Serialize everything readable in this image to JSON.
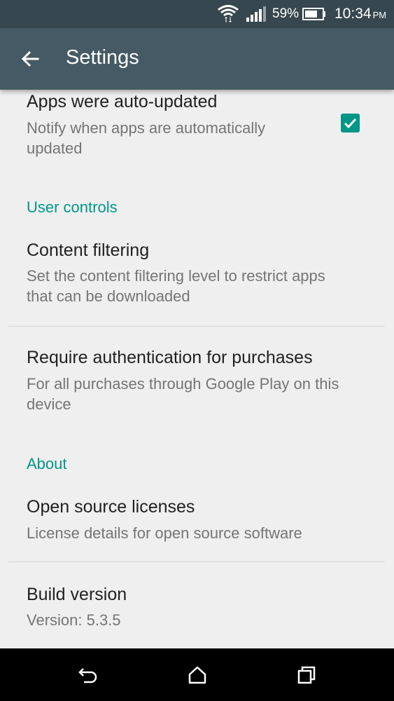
{
  "status_bar": {
    "battery_percent": "59%",
    "time": "10:34",
    "ampm": "PM"
  },
  "toolbar": {
    "title": "Settings"
  },
  "items": {
    "auto_updated": {
      "title": "Apps were auto-updated",
      "subtitle": "Notify when apps are automatically updated",
      "checked": true
    },
    "section_user_controls": "User controls",
    "content_filtering": {
      "title": "Content filtering",
      "subtitle": "Set the content filtering level to restrict apps that can be downloaded"
    },
    "require_auth": {
      "title": "Require authentication for purchases",
      "subtitle": "For all purchases through Google Play on this device"
    },
    "section_about": "About",
    "open_source": {
      "title": "Open source licenses",
      "subtitle": "License details for open source software"
    },
    "build_version": {
      "title": "Build version",
      "subtitle": "Version: 5.3.5"
    }
  },
  "colors": {
    "accent": "#009688",
    "toolbar": "#455a64",
    "status_bar": "#37474f",
    "background": "#efefef"
  }
}
